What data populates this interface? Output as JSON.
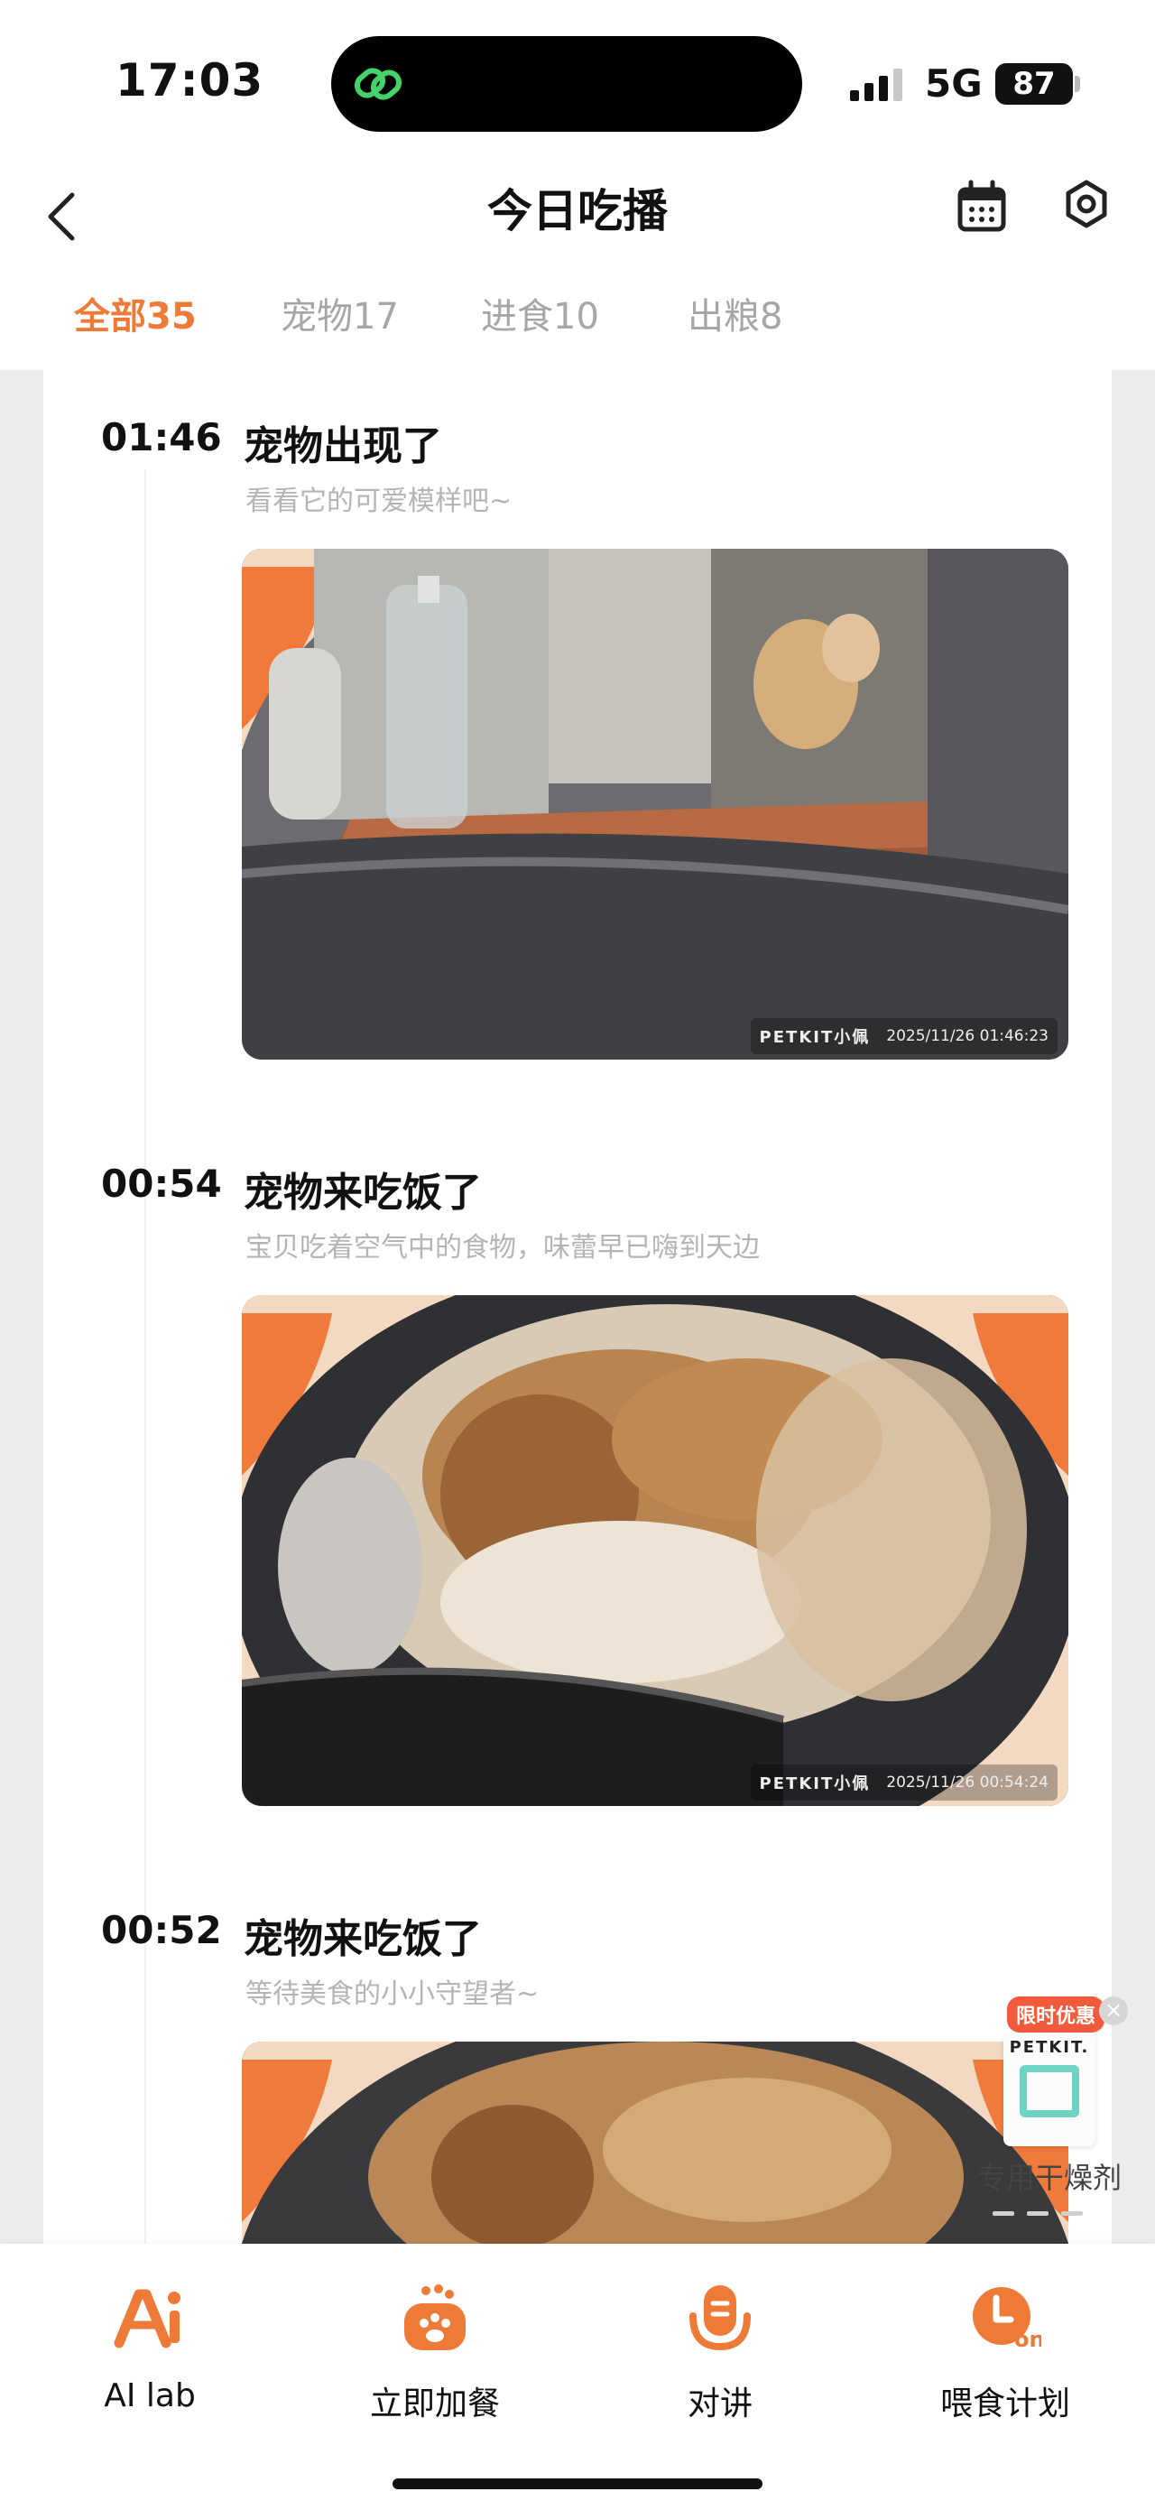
{
  "status_bar": {
    "time": "17:03",
    "network": "5G",
    "battery": "87"
  },
  "header": {
    "title": "今日吃播",
    "icons": [
      "back-icon",
      "calendar-icon",
      "settings-icon"
    ]
  },
  "tabs": [
    {
      "label": "全部35",
      "active": true
    },
    {
      "label": "宠物17",
      "active": false
    },
    {
      "label": "进食10",
      "active": false
    },
    {
      "label": "出粮8",
      "active": false
    }
  ],
  "events": [
    {
      "time": "01:46",
      "title": "宠物出现了",
      "subtitle": "看看它的可爱模样吧~",
      "watermark_brand": "PETKIT小佩",
      "watermark_time": "2025/11/26  01:46:23"
    },
    {
      "time": "00:54",
      "title": "宠物来吃饭了",
      "subtitle": "宝贝吃着空气中的食物，味蕾早已嗨到天边",
      "watermark_brand": "PETKIT小佩",
      "watermark_time": "2025/11/26  00:54:24"
    },
    {
      "time": "00:52",
      "title": "宠物来吃饭了",
      "subtitle": "等待美食的小小守望者~"
    }
  ],
  "ad": {
    "badge": "限时优惠",
    "brand": "PETKIT.",
    "label": "专用干燥剂",
    "close": "×"
  },
  "bottom_bar": [
    {
      "label": "AI lab",
      "icon": "ai-lab-icon"
    },
    {
      "label": "立即加餐",
      "icon": "add-meal-icon"
    },
    {
      "label": "对讲",
      "icon": "intercom-icon"
    },
    {
      "label": "喂食计划",
      "icon": "feeding-plan-icon"
    }
  ],
  "colors": {
    "accent": "#ee7a38",
    "tab_inactive": "#a6a6a6",
    "subtitle": "#b4b4b4"
  }
}
